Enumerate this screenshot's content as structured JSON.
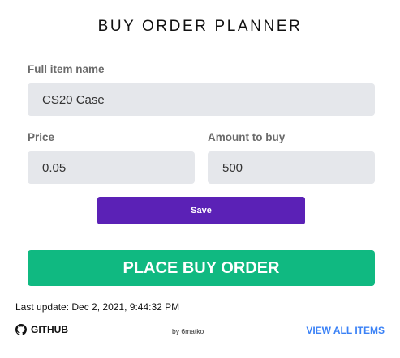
{
  "title": "BUY ORDER PLANNER",
  "form": {
    "item_name_label": "Full item name",
    "item_name_value": "CS20 Case",
    "price_label": "Price",
    "price_value": "0.05",
    "amount_label": "Amount to buy",
    "amount_value": "500",
    "save_label": "Save"
  },
  "actions": {
    "place_order_label": "PLACE BUY ORDER"
  },
  "status": {
    "last_update": "Last update: Dec 2, 2021, 9:44:32 PM"
  },
  "footer": {
    "github_label": "GITHUB",
    "github_icon": "github-icon",
    "byline": "by 6matko",
    "view_all_label": "VIEW ALL ITEMS"
  },
  "colors": {
    "save_button": "#5b21b6",
    "place_order_button": "#10b981",
    "link": "#3b82f6",
    "input_background": "#e5e7eb"
  }
}
